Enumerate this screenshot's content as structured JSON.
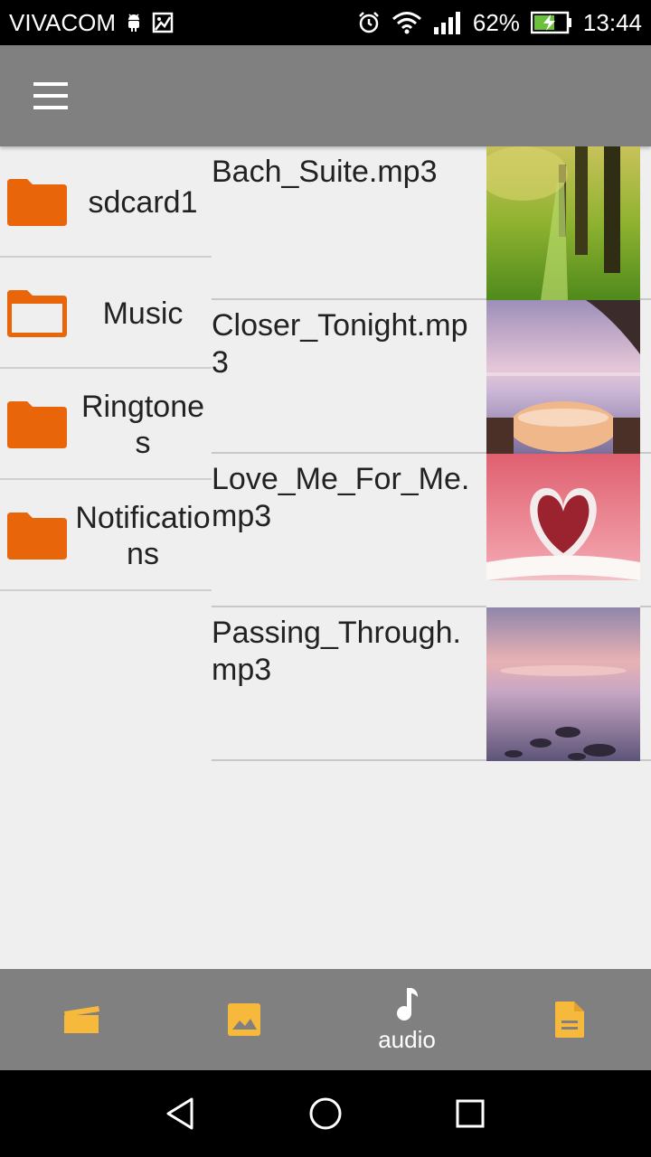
{
  "status_bar": {
    "carrier": "VIVACOM",
    "battery_percent": "62%",
    "time": "13:44",
    "icons": [
      "android-debug-icon",
      "image-notification-icon",
      "alarm-icon",
      "wifi-icon",
      "signal-icon",
      "battery-charging-icon"
    ]
  },
  "app_bar": {
    "menu_icon": "hamburger-menu-icon"
  },
  "folders": [
    {
      "label": "sdcard1",
      "icon": "folder-filled-icon"
    },
    {
      "label": "Music",
      "icon": "folder-open-icon"
    },
    {
      "label": "Ringtones",
      "icon": "folder-filled-icon"
    },
    {
      "label": "Notifications",
      "icon": "folder-filled-icon"
    }
  ],
  "files": [
    {
      "name": "Bach_Suite.mp3",
      "thumbnail": "tree-path-thumbnail"
    },
    {
      "name": "Closer_Tonight.mp3",
      "thumbnail": "sunset-table-thumbnail"
    },
    {
      "name": "Love_Me_For_Me.mp3",
      "thumbnail": "heart-book-thumbnail"
    },
    {
      "name": "Passing_Through.mp3",
      "thumbnail": "lake-stones-thumbnail"
    }
  ],
  "tabs": [
    {
      "id": "video",
      "icon": "video-clapper-icon",
      "label": ""
    },
    {
      "id": "image",
      "icon": "image-icon",
      "label": ""
    },
    {
      "id": "audio",
      "icon": "music-note-icon",
      "label": "audio",
      "active": true
    },
    {
      "id": "document",
      "icon": "document-icon",
      "label": ""
    }
  ],
  "colors": {
    "accent": "#e8650a",
    "tab_icon": "#f6b93b",
    "app_bar": "#808080"
  }
}
